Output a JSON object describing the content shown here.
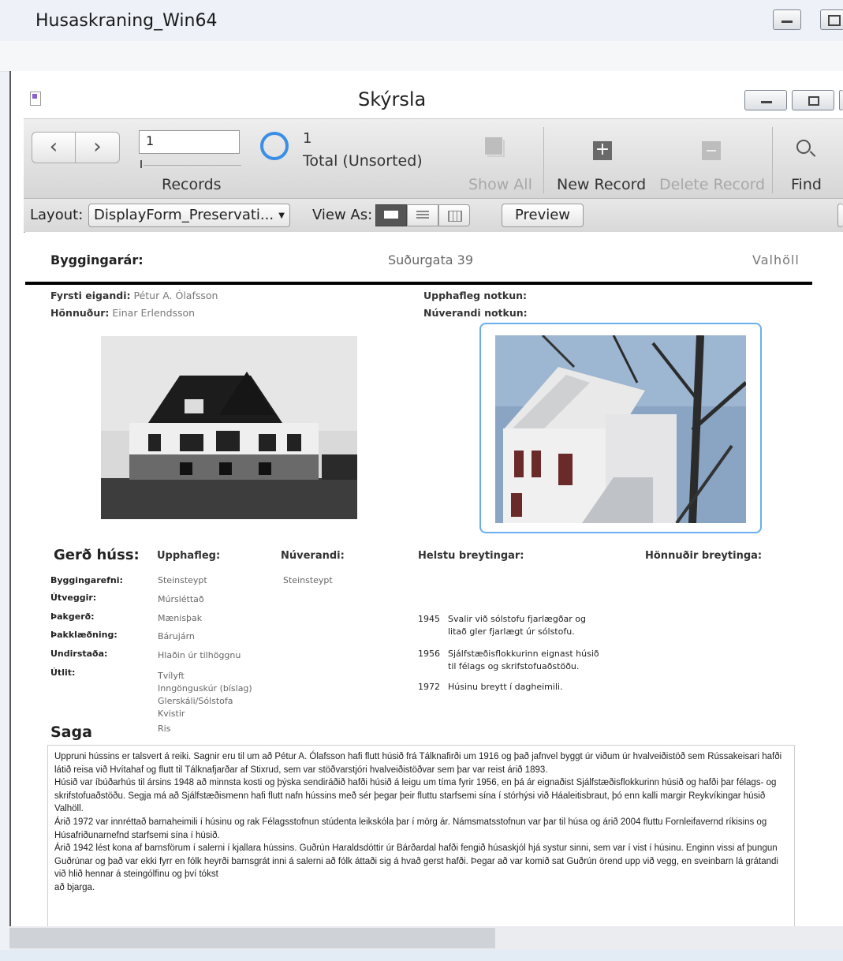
{
  "outer_window": {
    "title": "Husaskraning_Win64"
  },
  "inner_window": {
    "title": "Skýrsla"
  },
  "toolbar": {
    "record_value": "1",
    "records_label": "Records",
    "found_count": "1",
    "total_label": "Total (Unsorted)",
    "show_all": "Show All",
    "new_record": "New Record",
    "delete_record": "Delete Record",
    "find": "Find"
  },
  "layout_bar": {
    "layout_label": "Layout:",
    "layout_value": "DisplayForm_Preservati...",
    "view_as_label": "View As:",
    "preview": "Preview"
  },
  "record": {
    "byggingarar_label": "Byggingarár:",
    "address": "Suðurgata 39",
    "house_name": "Valhöll",
    "fyrsti_eigandi_label": "Fyrsti eigandi:",
    "fyrsti_eigandi": "Pétur A. Ólafsson",
    "honnudur_label": "Hönnuður:",
    "honnudur": "Einar Erlendsson",
    "upphafleg_notkun_label": "Upphafleg notkun:",
    "nuverandi_notkun_label": "Núverandi notkun:"
  },
  "gerd": {
    "title": "Gerð húss:",
    "col_upphafleg": "Upphafleg:",
    "col_nuverandi": "Núverandi:",
    "col_breytingar": "Helstu breytingar:",
    "col_honnudir": "Hönnuðir breytinga:",
    "rows": [
      {
        "label": "Byggingarefni:",
        "orig": "Steinsteypt",
        "now": "Steinsteypt"
      },
      {
        "label": "Útveggir:",
        "orig": "Múrsléttað",
        "now": ""
      },
      {
        "label": "Þakgerð:",
        "orig": "Mænisþak",
        "now": ""
      },
      {
        "label": "Þakklæðning:",
        "orig": "Bárujárn",
        "now": ""
      },
      {
        "label": "Undirstaða:",
        "orig": "Hlaðin úr tilhöggnu",
        "now": ""
      },
      {
        "label": "Útlit:",
        "orig": "Tvílyft",
        "now": ""
      }
    ],
    "utlit_extra": [
      "Inngönguskúr (bíslag)",
      "Glerskáli/Sólstofa",
      "Kvistir",
      "Ris"
    ],
    "changes": [
      {
        "year": "1945",
        "text": "Svalir við sólstofu fjarlægðar og",
        "text2": "litað gler fjarlægt úr sólstofu."
      },
      {
        "year": "1956",
        "text": "Sjálfstæðisflokkurinn eignast húsið",
        "text2": "til félags og skrifstofuaðstöðu."
      },
      {
        "year": "1972",
        "text": "Húsinu breytt í dagheimili.",
        "text2": ""
      }
    ]
  },
  "saga": {
    "title": "Saga",
    "text": "Uppruni hússins er talsvert á reiki. Sagnir eru til um að Pétur A. Ólafsson hafi flutt húsið frá Tálknafirði um 1916 og það jafnvel byggt úr viðum úr hvalveiðistöð sem Rússakeisari hafði látið reisa við Hvítahaf og flutt til Tálknafjarðar af Stixrud, sem var stöðvarstjóri hvalveiðistöðvar sem þar var reist árið 1893.\nHúsið var íbúðarhús til ársins 1948 að minnsta kosti og þýska sendiráðið hafði húsið á leigu um tíma fyrir 1956, en þá ár eignaðist Sjálfstæðisflokkurinn húsið og hafði þar félags- og skrifstofuaðstöðu. Segja má að Sjálfstæðismenn hafi flutt nafn hússins með sér þegar þeir fluttu starfsemi sína í stórhýsi við Háaleitisbraut, þó enn kalli margir Reykvíkingar húsið Valhöll.\nÁrið 1972 var innréttað barnaheimili í húsinu og rak Félagsstofnun stúdenta leikskóla þar í mörg ár. Námsmatsstofnun var þar til húsa og árið 2004 fluttu Fornleifavernd ríkisins og Húsafriðunarnefnd starfsemi sína í húsið.\nÁrið 1942 lést kona af barnsförum í salerni í kjallara hússins. Guðrún Haraldsdóttir úr Bárðardal hafði fengið húsaskjól hjá systur sinni, sem var í vist í húsinu. Enginn vissi af þungun Guðrúnar og það var ekki fyrr en fólk heyrði barnsgrát inni á salerni að fólk áttaði sig á hvað gerst hafði. Þegar að var komið sat Guðrún örend upp við vegg, en sveinbarn lá grátandi við hlið hennar á steingólfinu og því tókst\nað bjarga."
  }
}
